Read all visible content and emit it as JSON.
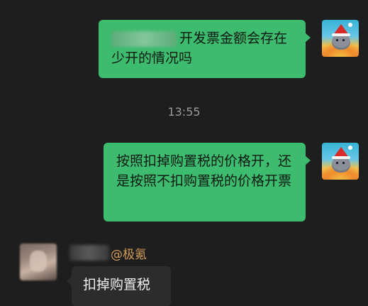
{
  "messages": [
    {
      "direction": "sent",
      "text": "开发票金额会存在少开的情况吗",
      "prefix_obscured": true
    },
    {
      "direction": "sent",
      "text": "按照扣掉购置税的价格开，还是按照不扣购置税的价格开票"
    },
    {
      "direction": "received",
      "sender_suffix": "@极氪",
      "sender_name_obscured": true,
      "text": "扣掉购置税"
    }
  ],
  "timestamp": "13:55",
  "colors": {
    "background": "#1e1e1e",
    "sent_bubble": "#3dbb6e",
    "received_bubble": "#2c2c2c",
    "sender_name": "#d29c5a",
    "timestamp": "#9b9b9b"
  }
}
